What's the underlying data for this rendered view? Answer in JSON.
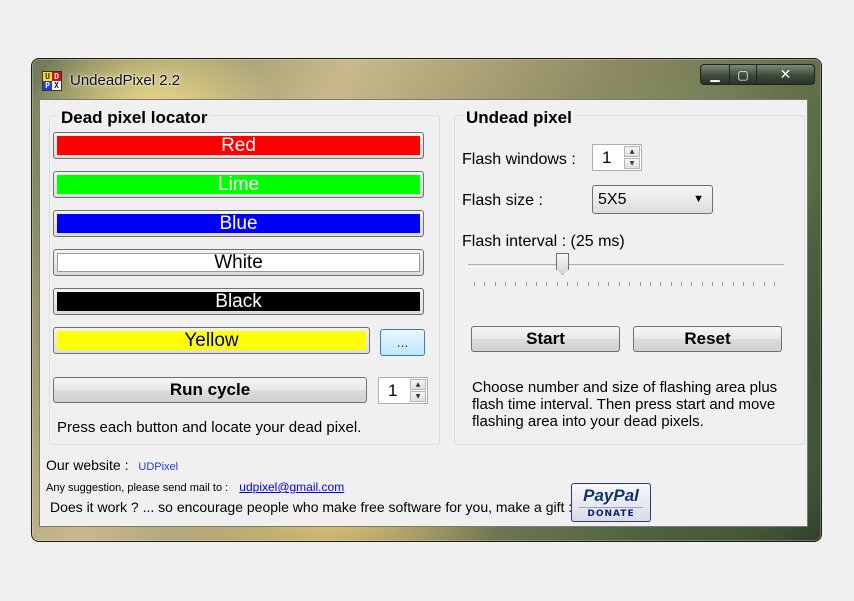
{
  "window": {
    "title": "UndeadPixel 2.2",
    "icon_letters": [
      "U",
      "D",
      "P",
      "X"
    ],
    "controls": {
      "minimize": "▁",
      "maximize": "▢",
      "close": "✕"
    }
  },
  "locator": {
    "title": "Dead pixel locator",
    "buttons": [
      {
        "label": "Red",
        "color": "#ff0000",
        "text_color": "#ffffff"
      },
      {
        "label": "Lime",
        "color": "#00ff00",
        "text_color": "#ffffff"
      },
      {
        "label": "Blue",
        "color": "#0000ff",
        "text_color": "#ffffff"
      },
      {
        "label": "White",
        "color": "#ffffff",
        "text_color": "#000000"
      },
      {
        "label": "Black",
        "color": "#000000",
        "text_color": "#ffffff"
      },
      {
        "label": "Yellow",
        "color": "#ffff00",
        "text_color": "#000080"
      }
    ],
    "more_colors_label": "...",
    "run_cycle_label": "Run cycle",
    "cycle_count": "1",
    "hint": "Press each button and locate your dead pixel."
  },
  "undead": {
    "title": "Undead pixel",
    "flash_windows_label": "Flash windows :",
    "flash_windows_value": "1",
    "flash_size_label": "Flash size :",
    "flash_size_value": "5X5",
    "flash_interval_label": "Flash interval :",
    "flash_interval_value": "(25 ms)",
    "slider_fraction": 0.29,
    "start_label": "Start",
    "reset_label": "Reset",
    "description": "Choose number and size of flashing area plus flash time interval. Then press start and move flashing area into your dead pixels."
  },
  "footer": {
    "website_label": "Our website :",
    "website_link": "UDPixel",
    "mail_label": "Any suggestion, please send mail to :",
    "mail_link": "udpixel@gmail.com",
    "gift_text": "Does it work ? ... so encourage people who make free software for you, make a gift :",
    "paypal_brand": "PayPal",
    "paypal_donate": "DONATE"
  }
}
